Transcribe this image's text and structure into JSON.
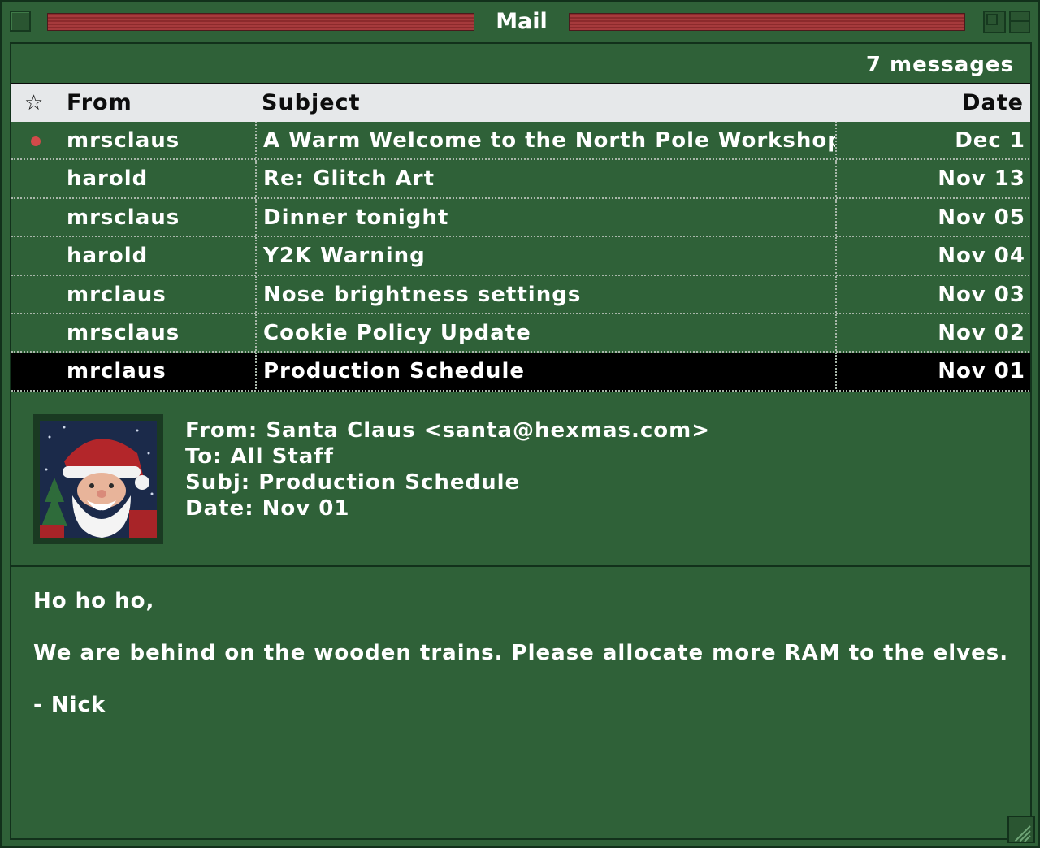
{
  "window": {
    "title": "Mail"
  },
  "mailbox": {
    "count_label": "7 messages",
    "columns": {
      "from": "From",
      "subject": "Subject",
      "date": "Date"
    },
    "messages": [
      {
        "from": "mrsclaus",
        "subject": "A Warm Welcome to the North Pole Workshop",
        "date": "Dec 1",
        "unread": true,
        "selected": false
      },
      {
        "from": "harold",
        "subject": "Re: Glitch Art",
        "date": "Nov 13",
        "unread": false,
        "selected": false
      },
      {
        "from": "mrsclaus",
        "subject": "Dinner tonight",
        "date": "Nov 05",
        "unread": false,
        "selected": false
      },
      {
        "from": "harold",
        "subject": "Y2K Warning",
        "date": "Nov 04",
        "unread": false,
        "selected": false
      },
      {
        "from": "mrclaus",
        "subject": "Nose brightness settings",
        "date": "Nov 03",
        "unread": false,
        "selected": false
      },
      {
        "from": "mrsclaus",
        "subject": "Cookie Policy Update",
        "date": "Nov 02",
        "unread": false,
        "selected": false
      },
      {
        "from": "mrclaus",
        "subject": "Production Schedule",
        "date": "Nov 01",
        "unread": false,
        "selected": true
      }
    ]
  },
  "message": {
    "from_line": "From: Santa Claus <santa@hexmas.com>",
    "to_line": "To: All Staff",
    "subj_line": "Subj: Production Schedule",
    "date_line": "Date: Nov 01",
    "body": [
      "Ho ho ho,",
      "We are behind on the wooden trains. Please allocate more RAM to the elves.",
      "- Nick"
    ]
  },
  "colors": {
    "window_bg": "#2f6138",
    "title_stripes": "#a63a3c",
    "header_bg": "#e6e8ea",
    "selected_row": "#000000",
    "unread_dot": "#d24a4a",
    "text": "#ffffff"
  },
  "icons": {
    "star": "star-outline-icon",
    "close": "close-box-icon",
    "zoom": "zoom-box-icon",
    "resize": "resize-grip-icon"
  }
}
